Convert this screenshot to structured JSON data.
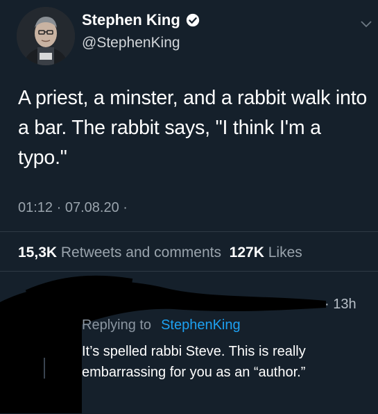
{
  "author": {
    "display_name": "Stephen King",
    "handle": "@StephenKing",
    "verified": true,
    "verified_icon": "verified-badge-icon"
  },
  "tweet": {
    "text": "A priest, a minster, and a rabbit walk into a bar. The rabbit says, \"I think I'm a typo.\"",
    "time": "01:12",
    "date": "07.08.20",
    "meta_separator": "·"
  },
  "stats": {
    "retweets_count": "15,3K",
    "retweets_label": "Retweets and comments",
    "likes_count": "127K",
    "likes_label": "Likes"
  },
  "reply": {
    "time_ago": "· 13h",
    "replying_to_label": "Replying to",
    "replying_to_handle": "StephenKing",
    "text": "It’s spelled rabbi Steve. This is really embarrassing for you as an “author.”"
  },
  "colors": {
    "background": "#15202b",
    "link": "#1da1f2",
    "secondary_text": "#9aa4ad"
  }
}
